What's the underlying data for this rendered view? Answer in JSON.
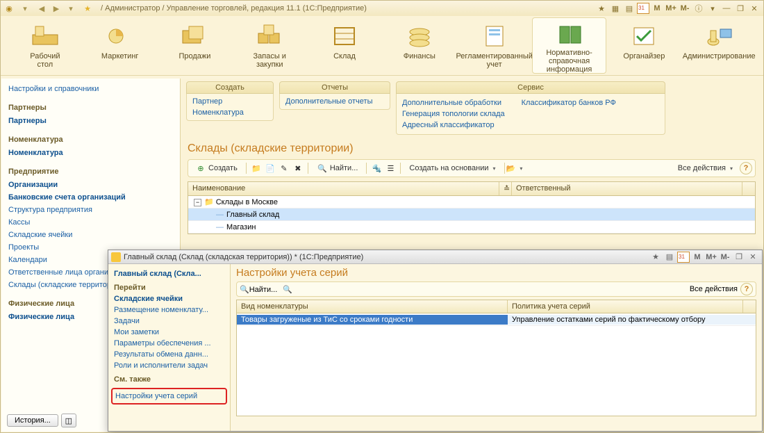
{
  "titlebar": {
    "text": "/ Администратор / Управление торговлей, редакция 11.1  (1С:Предприятие)",
    "m": "M",
    "mp": "M+",
    "mm": "M-"
  },
  "sections": [
    {
      "label": "Рабочий\nстол"
    },
    {
      "label": "Маркетинг"
    },
    {
      "label": "Продажи"
    },
    {
      "label": "Запасы и\nзакупки"
    },
    {
      "label": "Склад"
    },
    {
      "label": "Финансы"
    },
    {
      "label": "Регламентированный\nучет"
    },
    {
      "label": "Нормативно-справочная\nинформация"
    },
    {
      "label": "Органайзер"
    },
    {
      "label": "Администрирование"
    }
  ],
  "leftnav": {
    "top": "Настройки и справочники",
    "g1_title": "Партнеры",
    "g1_a": "Партнеры",
    "g2_title": "Номенклатура",
    "g2_a": "Номенклатура",
    "g3_title": "Предприятие",
    "g3_items": [
      "Организации",
      "Банковские счета организаций",
      "Структура предприятия",
      "Кассы",
      "Складские ячейки",
      "Проекты",
      "Календари",
      "Ответственные лица организаций",
      "Склады (складские территории)"
    ],
    "g4_title": "Физические лица",
    "g4_a": "Физические лица",
    "history": "История..."
  },
  "cmdbar": {
    "c1_title": "Создать",
    "c1_items": [
      "Партнер",
      "Номенклатура"
    ],
    "c2_title": "Отчеты",
    "c2_items": [
      "Дополнительные отчеты"
    ],
    "c3_title": "Сервис",
    "c3_col1": [
      "Дополнительные обработки",
      "Генерация топологии склада",
      "Адресный классификатор"
    ],
    "c3_col2": [
      "Классификатор банков РФ"
    ]
  },
  "content": {
    "title": "Склады (складские территории)",
    "create": "Создать",
    "find": "Найти...",
    "create_based": "Создать на основании",
    "all_actions": "Все действия",
    "head_name": "Наименование",
    "head_resp": "Ответственный",
    "rows": {
      "r0": "Склады в Москве",
      "r1": "Главный склад",
      "r2": "Магазин"
    }
  },
  "inner": {
    "title": "Главный склад (Склад (складская территория)) *  (1С:Предприятие)",
    "m": "M",
    "mp": "M+",
    "mm": "M-",
    "nav_head": "Главный склад (Скла...",
    "nav_goto": "Перейти",
    "nav_items": [
      "Складские ячейки",
      "Размещение номенклату...",
      "Задачи",
      "Мои заметки",
      "Параметры обеспечения ...",
      "Результаты обмена данн...",
      "Роли и исполнители задач"
    ],
    "nav_see": "См. также",
    "nav_boxed": "Настройки учета серий",
    "main_title": "Настройки учета серий",
    "find": "Найти...",
    "all_actions": "Все действия",
    "grid_head_c1": "Вид номенклатуры",
    "grid_head_c2": "Политика учета серий",
    "row_c1": "Товары загруженые из ТиС со сроками годности",
    "row_c2": "Управление остатками серий по фактическому отбору"
  }
}
